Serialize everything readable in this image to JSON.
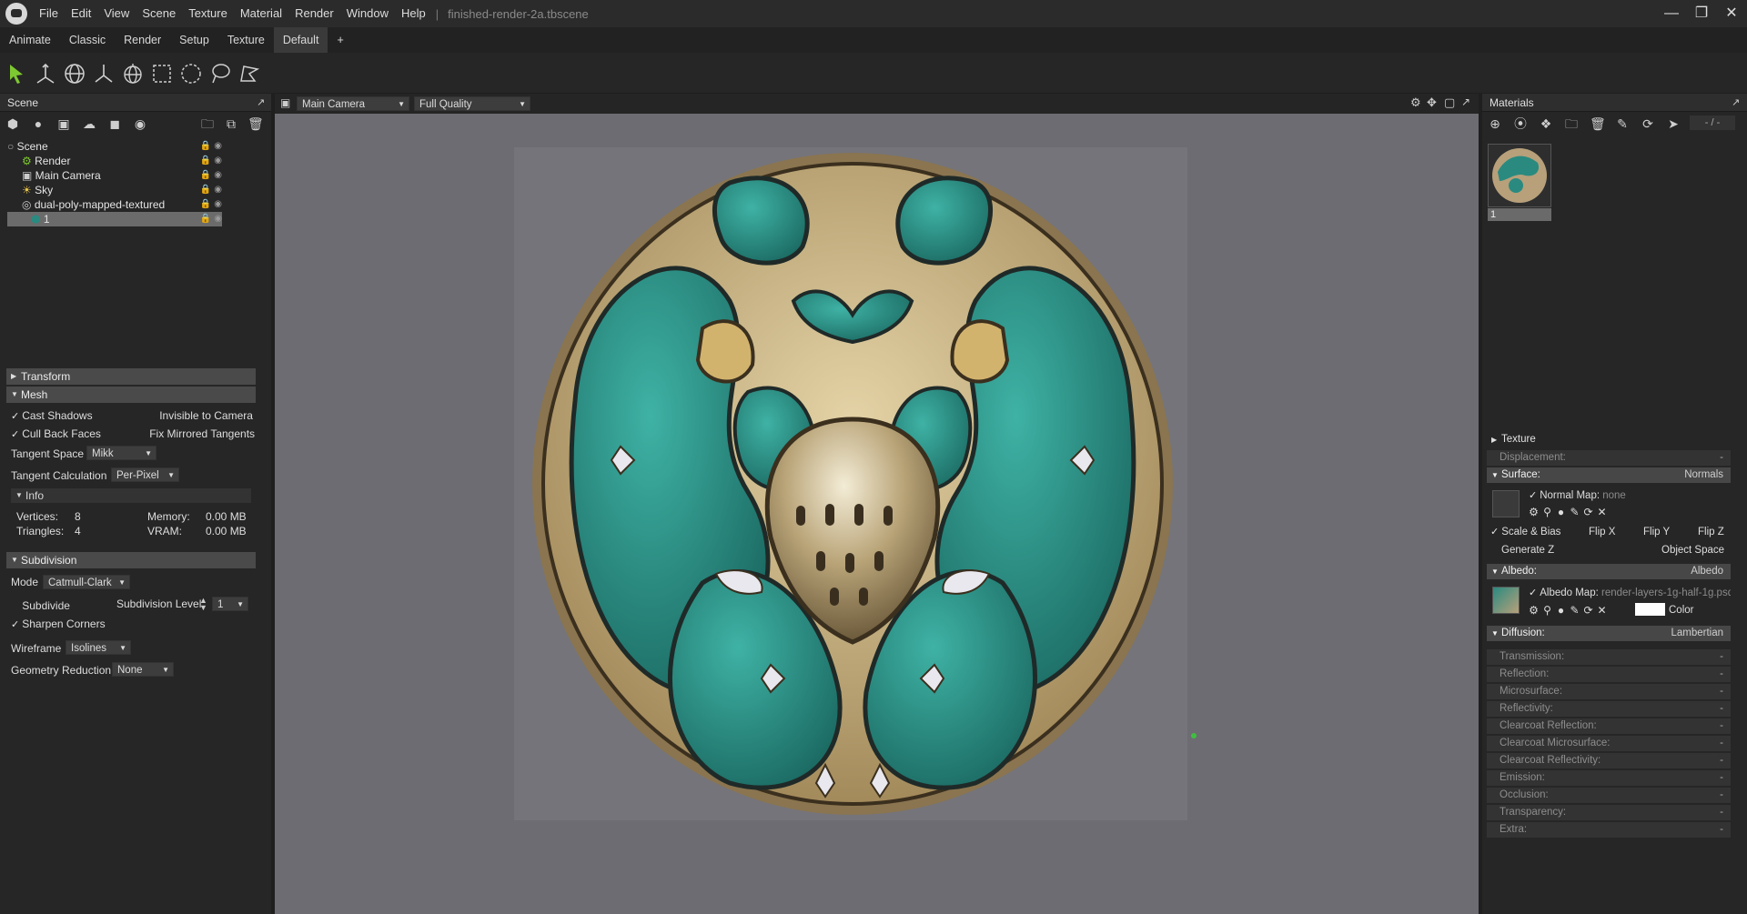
{
  "app": {
    "menu": [
      "File",
      "Edit",
      "View",
      "Scene",
      "Texture",
      "Material",
      "Render",
      "Window",
      "Help"
    ],
    "filename": "finished-render-2a.tbscene",
    "separator": "|"
  },
  "tabs": [
    "Animate",
    "Classic",
    "Render",
    "Setup",
    "Texture",
    "Default",
    "+"
  ],
  "active_tab": "Default",
  "scene": {
    "title": "Scene",
    "tree": [
      {
        "label": "Scene",
        "icon": "scene-icon"
      },
      {
        "label": "Render",
        "icon": "gear-icon"
      },
      {
        "label": "Main Camera",
        "icon": "camera-icon"
      },
      {
        "label": "Sky",
        "icon": "sky-icon"
      },
      {
        "label": "dual-poly-mapped-textured",
        "icon": "object-icon"
      },
      {
        "label": "1",
        "icon": "mesh-icon"
      }
    ]
  },
  "properties": {
    "transform": "Transform",
    "mesh": "Mesh",
    "cast_shadows": "Cast Shadows",
    "invisible_to_camera": "Invisible to Camera",
    "cull_back_faces": "Cull Back Faces",
    "fix_mirrored_tangents": "Fix Mirrored Tangents",
    "tangent_space_label": "Tangent Space",
    "tangent_space_value": "Mikk",
    "tangent_calc_label": "Tangent Calculation",
    "tangent_calc_value": "Per-Pixel",
    "info": "Info",
    "vertices_label": "Vertices:",
    "vertices_value": "8",
    "triangles_label": "Triangles:",
    "triangles_value": "4",
    "memory_label": "Memory:",
    "memory_value": "0.00 MB",
    "vram_label": "VRAM:",
    "vram_value": "0.00 MB",
    "subdivision": "Subdivision",
    "mode_label": "Mode",
    "mode_value": "Catmull-Clark",
    "subdivide": "Subdivide",
    "subdivision_level_label": "Subdivision Level",
    "subdivision_level_value": "1",
    "sharpen_corners": "Sharpen Corners",
    "wireframe_label": "Wireframe",
    "wireframe_value": "Isolines",
    "geometry_reduction_label": "Geometry Reduction",
    "geometry_reduction_value": "None"
  },
  "viewport": {
    "camera": "Main Camera",
    "quality": "Full Quality"
  },
  "materials": {
    "title": "Materials",
    "counter": "- / -",
    "thumb_label": "1",
    "texture": "Texture",
    "displacement": "Displacement:",
    "displacement_value": "-",
    "surface": "Surface:",
    "surface_value": "Normals",
    "normal_map_label": "Normal Map:",
    "normal_map_value": "none",
    "scale_bias": "Scale & Bias",
    "flip_x": "Flip X",
    "flip_y": "Flip Y",
    "flip_z": "Flip Z",
    "generate_z": "Generate Z",
    "object_space": "Object Space",
    "albedo": "Albedo:",
    "albedo_value": "Albedo",
    "albedo_map_label": "Albedo Map:",
    "albedo_map_value": "render-layers-1g-half-1g.psd",
    "color_label": "Color",
    "diffusion": "Diffusion:",
    "diffusion_value": "Lambertian",
    "rows": [
      "Transmission:",
      "Reflection:",
      "Microsurface:",
      "Reflectivity:",
      "Clearcoat Reflection:",
      "Clearcoat Microsurface:",
      "Clearcoat Reflectivity:",
      "Emission:",
      "Occlusion:",
      "Transparency:",
      "Extra:"
    ],
    "row_value": "-"
  },
  "colors": {
    "accent_green": "#7ec832",
    "teal": "#2a8a80",
    "gold": "#b9a376",
    "status_dot": "#3fbf3f"
  }
}
